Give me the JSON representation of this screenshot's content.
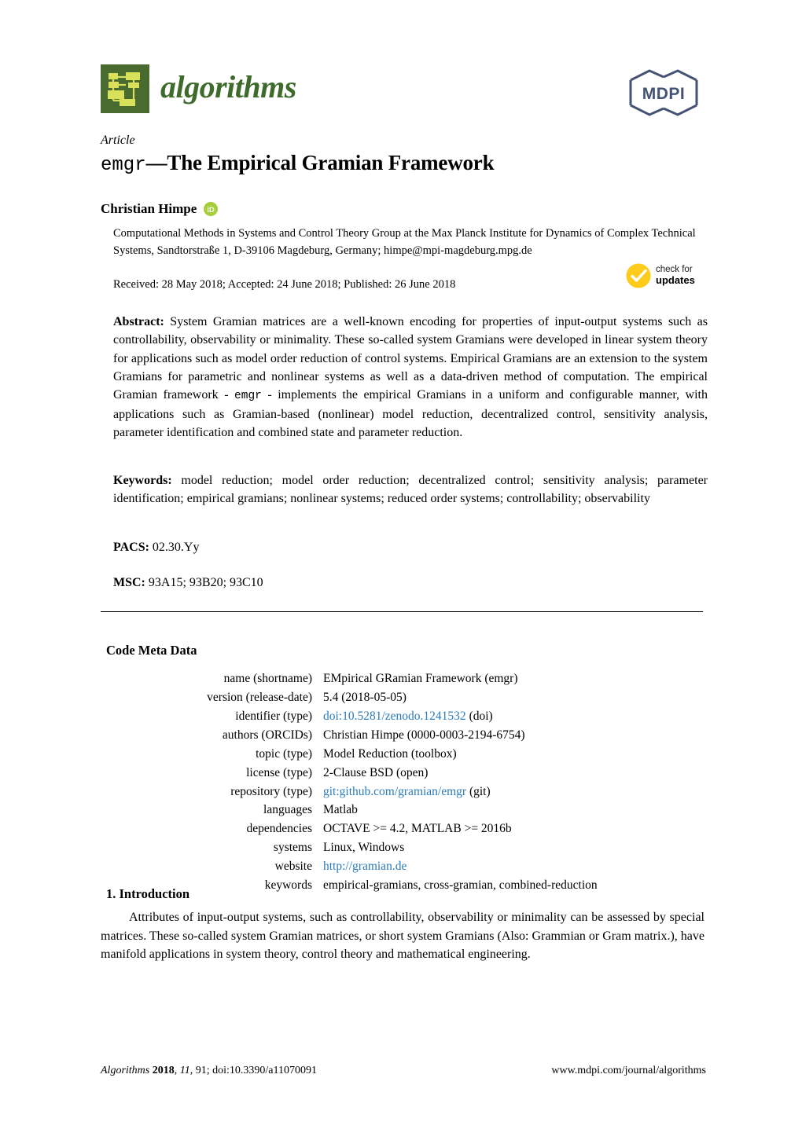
{
  "journal": {
    "name": "algorithms",
    "logo_icon": "algorithms-flowchart-logo",
    "logo_bg_color": "#4a6b30",
    "logo_block_color": "#d9e05a",
    "title_color": "#3e6b2b"
  },
  "publisher": {
    "name": "MDPI",
    "logo_icon": "mdpi-hexagon-logo",
    "color": "#445374"
  },
  "article": {
    "type": "Article",
    "title_mono": "emgr",
    "title_rest": "—The Empirical Gramian Framework"
  },
  "author": {
    "name": "Christian Himpe",
    "orcid_icon": "orcid-id-icon",
    "orcid_color": "#a6ce39",
    "affiliation": "Computational Methods in Systems and Control Theory Group at the Max Planck Institute for Dynamics of Complex Technical Systems, Sandtorstraße 1, D-39106 Magdeburg, Germany; himpe@mpi-magdeburg.mpg.de"
  },
  "dates": {
    "line": "Received: 28 May 2018; Accepted: 24 June 2018; Published: 26 June 2018"
  },
  "check_for_updates": {
    "icon": "check-circle-icon",
    "color": "#fdcb1a",
    "line1": "check for",
    "line2": "updates"
  },
  "abstract": {
    "label": "Abstract:",
    "part1": "System Gramian matrices are a well-known encoding for properties of input-output systems such as controllability, observability or minimality. These so-called system Gramians were developed in linear system theory for applications such as model order reduction of control systems. Empirical Gramians are an extension to the system Gramians for parametric and nonlinear systems as well as a data-driven method of computation. The empirical Gramian framework -",
    "mono": "emgr",
    "part2": "- implements the empirical Gramians in a uniform and configurable manner, with applications such as Gramian-based (nonlinear) model reduction, decentralized control, sensitivity analysis, parameter identification and combined state and parameter reduction."
  },
  "keywords": {
    "label": "Keywords:",
    "text": "model reduction; model order reduction; decentralized control; sensitivity analysis; parameter identification; empirical gramians; nonlinear systems; reduced order systems; controllability; observability"
  },
  "pacs": {
    "label": "PACS:",
    "text": "02.30.Yy"
  },
  "msc": {
    "label": "MSC:",
    "text": "93A15; 93B20; 93C10"
  },
  "code_meta": {
    "heading": "Code Meta Data",
    "rows": [
      {
        "key": "name (shortname)",
        "value": "EMpirical GRamian Framework (emgr)",
        "link": "",
        "suffix": ""
      },
      {
        "key": "version (release-date)",
        "value": "5.4 (2018-05-05)",
        "link": "",
        "suffix": ""
      },
      {
        "key": "identifier (type)",
        "value": "",
        "link": "doi:10.5281/zenodo.1241532",
        "suffix": " (doi)"
      },
      {
        "key": "authors (ORCIDs)",
        "value": "Christian Himpe (0000-0003-2194-6754)",
        "link": "",
        "suffix": ""
      },
      {
        "key": "topic (type)",
        "value": "Model Reduction (toolbox)",
        "link": "",
        "suffix": ""
      },
      {
        "key": "license (type)",
        "value": "2-Clause BSD (open)",
        "link": "",
        "suffix": ""
      },
      {
        "key": "repository (type)",
        "value": "",
        "link": "git:github.com/gramian/emgr",
        "suffix": " (git)"
      },
      {
        "key": "languages",
        "value": "Matlab",
        "link": "",
        "suffix": ""
      },
      {
        "key": "dependencies",
        "value": "OCTAVE >= 4.2, MATLAB >= 2016b",
        "link": "",
        "suffix": ""
      },
      {
        "key": "systems",
        "value": "Linux, Windows",
        "link": "",
        "suffix": ""
      },
      {
        "key": "website",
        "value": "",
        "link": "http://gramian.de",
        "suffix": ""
      },
      {
        "key": "keywords",
        "value": "empirical-gramians, cross-gramian, combined-reduction",
        "link": "",
        "suffix": ""
      }
    ]
  },
  "introduction": {
    "heading": "1. Introduction",
    "paragraph": "Attributes of input-output systems, such as controllability, observability or minimality can be assessed by special matrices. These so-called system Gramian matrices, or short system Gramians (Also: Grammian or Gram matrix.), have manifold applications in system theory, control theory and mathematical engineering."
  },
  "footer": {
    "journal": "Algorithms",
    "year": "2018",
    "volume": "11",
    "rest": ", 91; doi:10.3390/a11070091",
    "url": "www.mdpi.com/journal/algorithms"
  },
  "link_color": "#2b7bba"
}
